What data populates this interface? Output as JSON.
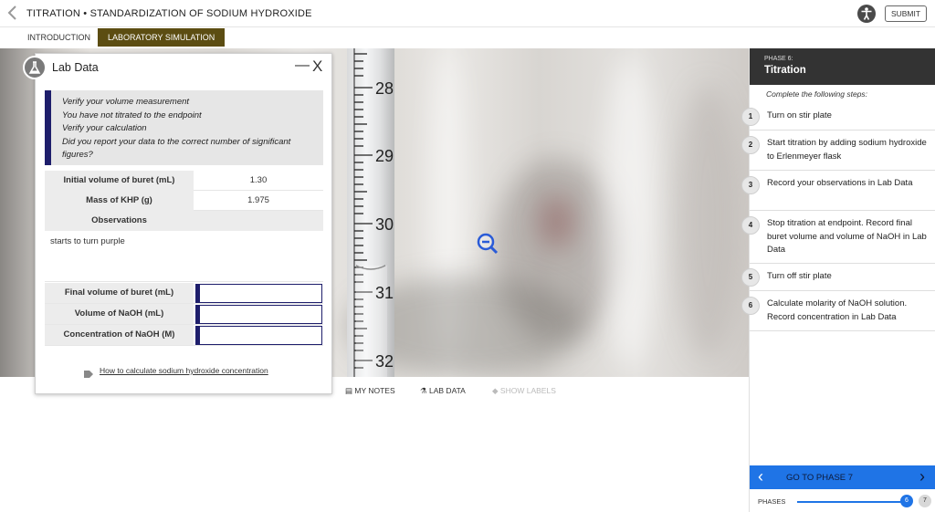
{
  "header": {
    "title": "TITRATION • STANDARDIZATION OF SODIUM HYDROXIDE",
    "submit_label": "SUBMIT"
  },
  "tabs": [
    {
      "label": "INTRODUCTION",
      "active": false
    },
    {
      "label": "LABORATORY SIMULATION",
      "active": true
    }
  ],
  "buret": {
    "tick_labels": [
      "28",
      "29",
      "30",
      "31",
      "32"
    ]
  },
  "toolbar": {
    "my_notes": "MY NOTES",
    "lab_data": "LAB DATA",
    "show_labels": "SHOW LABELS"
  },
  "lab_data": {
    "title": "Lab Data",
    "minimize_glyph": "—",
    "close_glyph": "X",
    "feedback": [
      "Verify your volume measurement",
      "You have not titrated to the endpoint",
      "Verify your calculation",
      "Did you report your data to the correct number of significant figures?"
    ],
    "rows": [
      {
        "label": "Initial volume of buret (mL)",
        "value": "1.30"
      },
      {
        "label": "Mass of KHP (g)",
        "value": "1.975"
      },
      {
        "label": "Observations",
        "value": ""
      }
    ],
    "observations_text": "starts to turn purple",
    "inputs": [
      {
        "label": "Final volume of buret (mL)",
        "value": ""
      },
      {
        "label": "Volume of NaOH (mL)",
        "value": ""
      },
      {
        "label": "Concentration of NaOH (M)",
        "value": ""
      }
    ],
    "help_link": "How to calculate sodium hydroxide concentration"
  },
  "sidebar": {
    "phase_label": "PHASE 6:",
    "phase_name": "Titration",
    "instruction": "Complete the following steps:",
    "steps": [
      {
        "num": "1",
        "text": "Turn on stir plate"
      },
      {
        "num": "2",
        "text": "Start titration by adding sodium hydroxide to Erlenmeyer flask"
      },
      {
        "num": "3",
        "text": "Record your observations in Lab Data"
      },
      {
        "num": "4",
        "text": "Stop titration at endpoint. Record final buret volume and volume of NaOH in Lab Data"
      },
      {
        "num": "5",
        "text": "Turn off stir plate"
      },
      {
        "num": "6",
        "text": "Calculate molarity of NaOH solution. Record concentration in Lab Data"
      }
    ],
    "goto_label": "GO TO PHASE 7",
    "phases_label": "PHASES",
    "current_phase": "6",
    "next_phase": "7"
  },
  "colors": {
    "accent_blue": "#1f74e6",
    "tab_active": "#5c4d12",
    "input_border": "#1e1e6b"
  }
}
